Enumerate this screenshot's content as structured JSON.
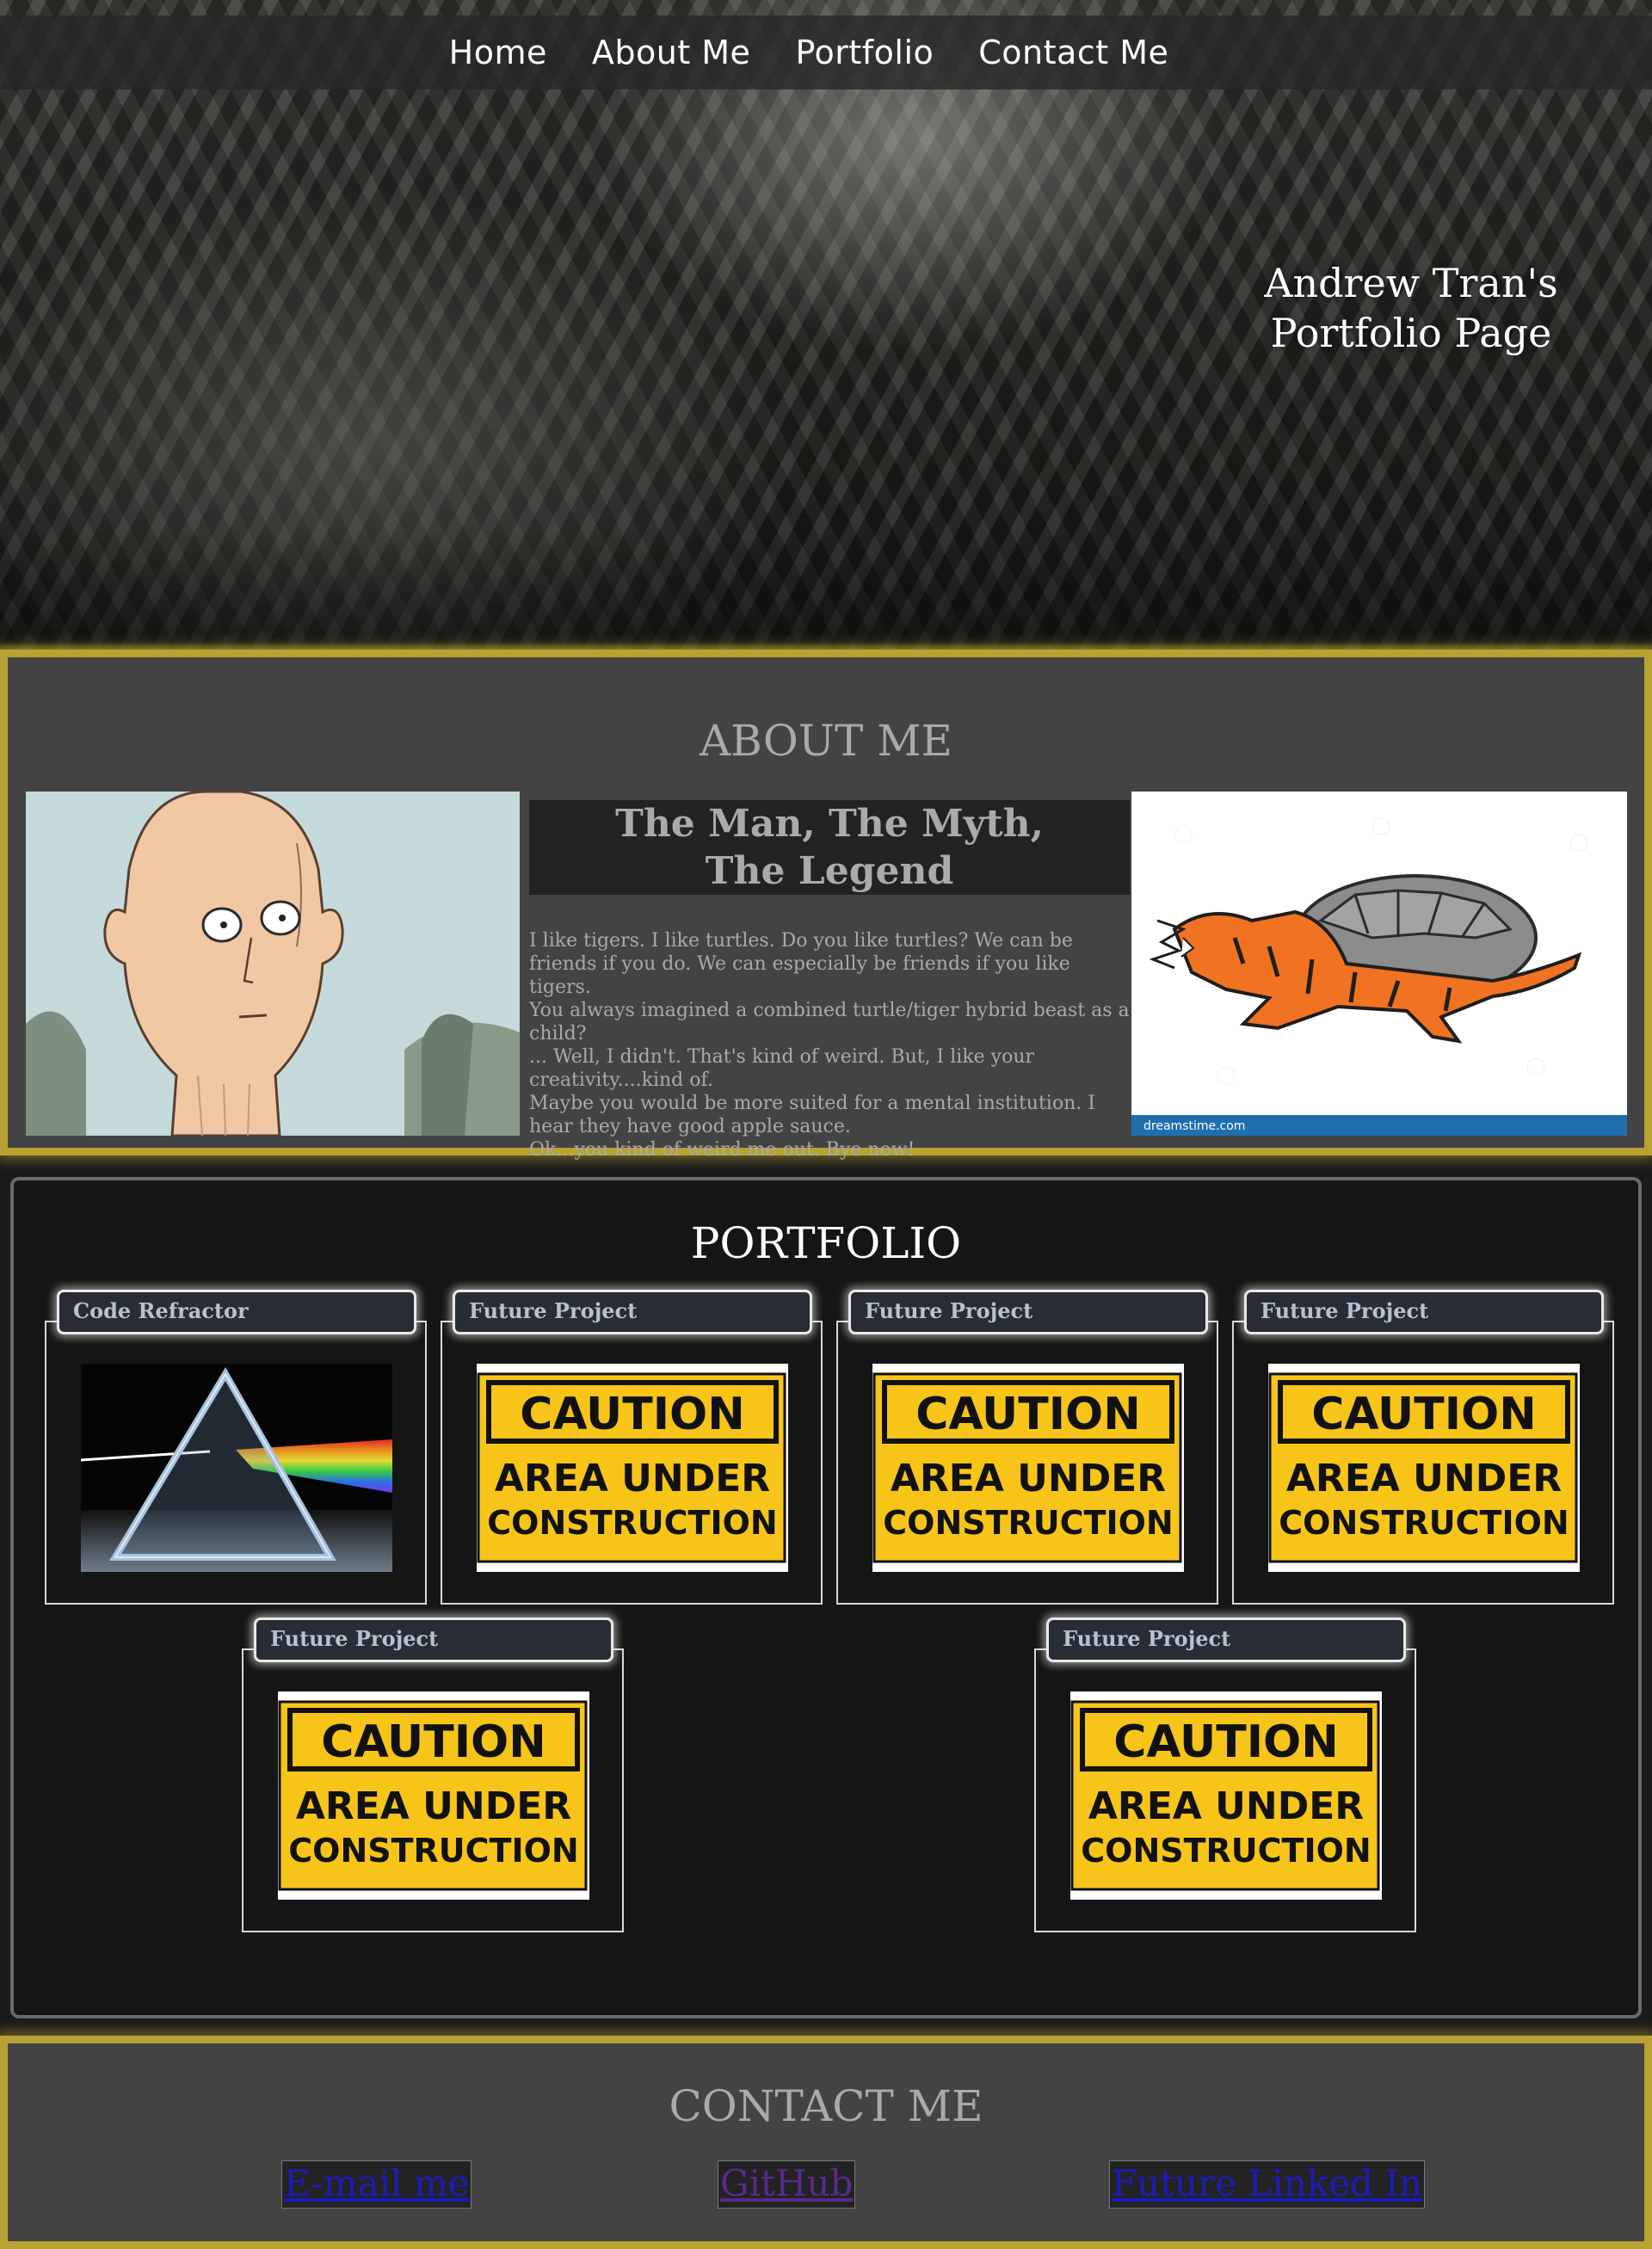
{
  "nav": {
    "items": [
      "Home",
      "About Me",
      "Portfolio",
      "Contact Me"
    ]
  },
  "hero": {
    "title": "Andrew Tran's\nPortfolio Page"
  },
  "about": {
    "heading": "ABOUT ME",
    "subheading": "The Man, The Myth,\nThe Legend",
    "text": "I like tigers. I like turtles. Do you like turtles? We can be friends if you do. We can especially be friends if you like tigers.\nYou always imagined a combined turtle/tiger hybrid beast as a child?\n... Well, I didn't. That's kind of weird. But, I like your creativity....kind of.\nMaybe you would be more suited for a mental institution. I hear they have good apple sauce.\nOk...you kind of weird me out. Bye now!",
    "right_image_footer": "dreamstime.com"
  },
  "portfolio": {
    "heading": "PORTFOLIO",
    "cards": [
      {
        "title": "Code Refractor",
        "image": "prism"
      },
      {
        "title": "Future Project",
        "image": "caution"
      },
      {
        "title": "Future Project",
        "image": "caution"
      },
      {
        "title": "Future Project",
        "image": "caution"
      },
      {
        "title": "Future Project",
        "image": "caution"
      },
      {
        "title": "Future Project",
        "image": "caution"
      }
    ],
    "caution_sign": {
      "line1": "CAUTION",
      "line2": "AREA UNDER",
      "line3": "CONSTRUCTION"
    }
  },
  "contact": {
    "heading": "CONTACT ME",
    "links": [
      "E-mail me",
      "GitHub",
      "Future Linked In"
    ]
  },
  "colors": {
    "accent_gold": "#b7a233",
    "caution_yellow": "#f7c51a",
    "card_tab_bg": "#272c35"
  }
}
